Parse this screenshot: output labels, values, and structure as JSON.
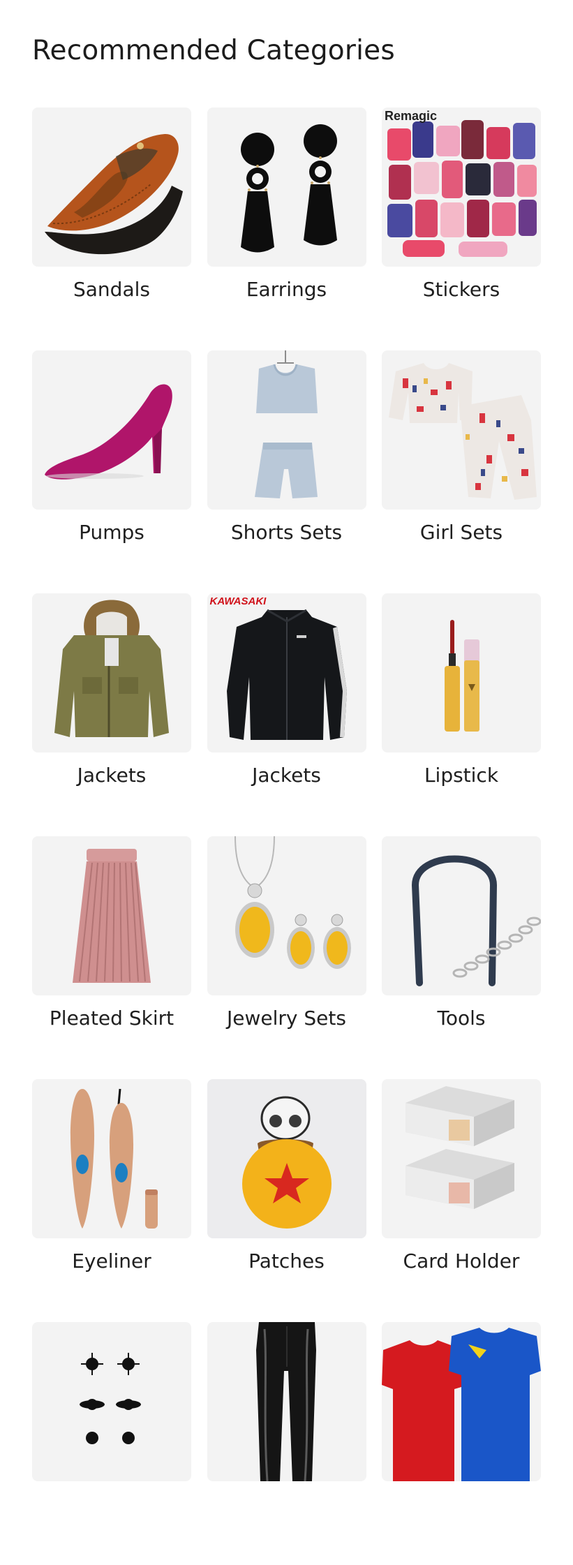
{
  "header": {
    "title": "Recommended Categories"
  },
  "categories": [
    {
      "label": "Sandals",
      "icon": "sandal-icon"
    },
    {
      "label": "Earrings",
      "icon": "earring-icon"
    },
    {
      "label": "Stickers",
      "icon": "sticker-pack-icon",
      "brand": "Remagic"
    },
    {
      "label": "Pumps",
      "icon": "pump-shoe-icon"
    },
    {
      "label": "Shorts Sets",
      "icon": "shorts-set-icon"
    },
    {
      "label": "Girl Sets",
      "icon": "girl-set-icon"
    },
    {
      "label": "Jackets",
      "icon": "parka-jacket-icon"
    },
    {
      "label": "Jackets",
      "icon": "track-jacket-icon",
      "brand": "KAWASAKI"
    },
    {
      "label": "Lipstick",
      "icon": "lip-gloss-icon"
    },
    {
      "label": "Pleated Skirt",
      "icon": "pleated-skirt-icon"
    },
    {
      "label": "Jewelry Sets",
      "icon": "jewelry-set-icon"
    },
    {
      "label": "Tools",
      "icon": "tool-icon"
    },
    {
      "label": "Eyeliner",
      "icon": "eyeliner-icon"
    },
    {
      "label": "Patches",
      "icon": "patch-icon"
    },
    {
      "label": "Card Holder",
      "icon": "card-holder-icon"
    },
    {
      "label": "",
      "icon": "nail-sticker-icon"
    },
    {
      "label": "",
      "icon": "leather-pants-icon"
    },
    {
      "label": "",
      "icon": "jersey-icon"
    }
  ],
  "colors": {
    "background": "#ffffff",
    "tile": "#f3f3f3",
    "text": "#1f1f1f"
  }
}
